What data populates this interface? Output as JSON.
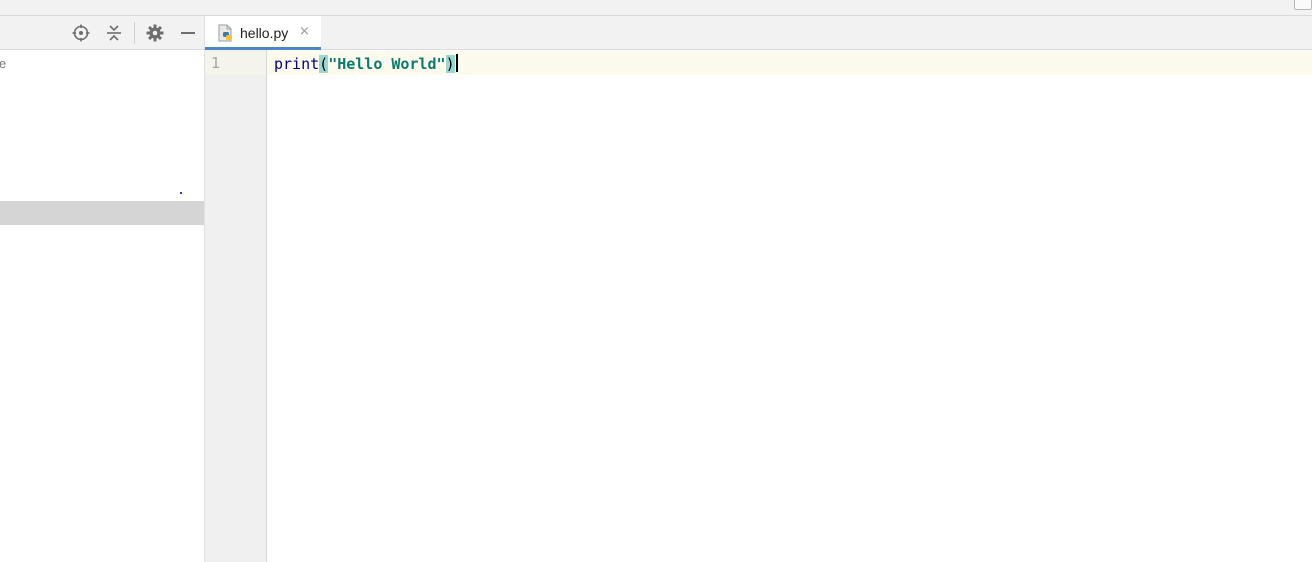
{
  "project_panel": {
    "toolbar": {
      "icons": [
        "locate-icon",
        "collapse-all-icon",
        "gear-icon",
        "minimize-icon"
      ]
    },
    "partial_tree_text": "e"
  },
  "editor": {
    "tabs": [
      {
        "label": "hello.py",
        "icon": "python-file-icon",
        "close": "×",
        "active": true
      }
    ],
    "lines": [
      {
        "number": "1",
        "tokens": {
          "func": "print",
          "open_paren": "(",
          "string": "\"Hello World\"",
          "close_paren": ")"
        }
      }
    ]
  },
  "colors": {
    "tab_underline": "#4a86c8",
    "current_line": "#fcfaed",
    "paren_highlight": "#99d8d0",
    "string": "#0b7a6e",
    "function": "#000080"
  }
}
